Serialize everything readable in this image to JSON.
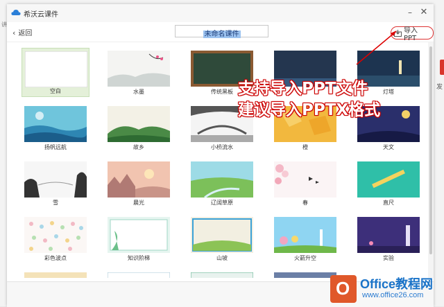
{
  "app": {
    "title": "希沃云课件"
  },
  "toolbar": {
    "back_label": "返回",
    "doc_title": "未命名课件",
    "import_label": "导入PPT"
  },
  "templates": [
    {
      "label": "空白",
      "selected": true
    },
    {
      "label": "水墨"
    },
    {
      "label": "传统黑板"
    },
    {
      "label": ""
    },
    {
      "label": "灯塔"
    },
    {
      "label": "扬帆远航"
    },
    {
      "label": "故乡"
    },
    {
      "label": "小桥流水"
    },
    {
      "label": "橙"
    },
    {
      "label": "天文"
    },
    {
      "label": "雪"
    },
    {
      "label": "晨光"
    },
    {
      "label": "辽阔草原"
    },
    {
      "label": "春"
    },
    {
      "label": "直尺"
    },
    {
      "label": "彩色波点"
    },
    {
      "label": "知识阶梯"
    },
    {
      "label": "山坡"
    },
    {
      "label": "火箭升空"
    },
    {
      "label": "实验"
    }
  ],
  "annotation": {
    "line1": "支持导入PPT文件",
    "line2": "建议导入PPTX格式"
  },
  "watermark": {
    "logo_letter": "O",
    "line1": "Office教程网",
    "line2": "www.office26.com"
  },
  "background": {
    "right_text": "发",
    "left_text": "讲"
  },
  "colors": {
    "accent_green": "#e4f0d9",
    "import_border": "#dd3333",
    "annotation_red": "#cc0000"
  }
}
